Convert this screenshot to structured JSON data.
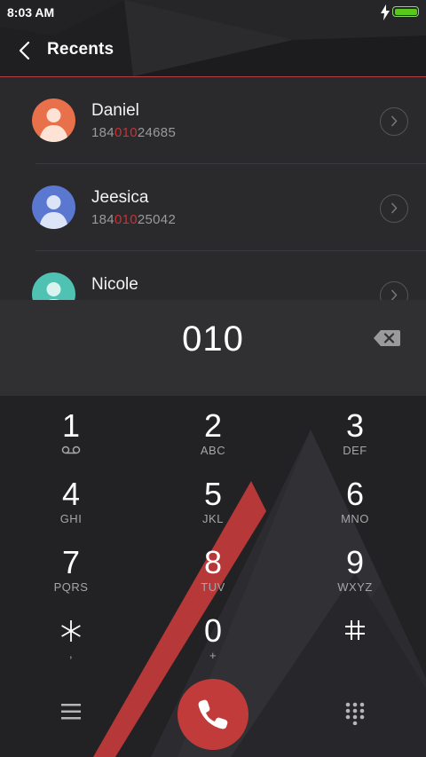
{
  "status_bar": {
    "time": "8:03 AM"
  },
  "header": {
    "title": "Recents"
  },
  "contacts": [
    {
      "name": "Daniel",
      "number_prefix": "184",
      "number_match": "010",
      "number_suffix": "24685",
      "avatar_color": "#e8704a"
    },
    {
      "name": "Jeesica",
      "number_prefix": "184",
      "number_match": "010",
      "number_suffix": "25042",
      "avatar_color": "#5b78d1"
    },
    {
      "name": "Nicole",
      "number_prefix": "",
      "number_match": "",
      "number_suffix": "",
      "avatar_color": "#4fc2b3"
    }
  ],
  "dialer": {
    "input": "010"
  },
  "keys": [
    {
      "digit": "1",
      "letters": "voicemail-icon"
    },
    {
      "digit": "2",
      "letters": "ABC"
    },
    {
      "digit": "3",
      "letters": "DEF"
    },
    {
      "digit": "4",
      "letters": "GHI"
    },
    {
      "digit": "5",
      "letters": "JKL"
    },
    {
      "digit": "6",
      "letters": "MNO"
    },
    {
      "digit": "7",
      "letters": "PQRS"
    },
    {
      "digit": "8",
      "letters": "TUV"
    },
    {
      "digit": "9",
      "letters": "WXYZ"
    },
    {
      "digit": "*",
      "letters": ","
    },
    {
      "digit": "0",
      "letters": "+"
    },
    {
      "digit": "#",
      "letters": ""
    }
  ],
  "colors": {
    "accent": "#c13b3b",
    "highlight": "#c93333",
    "header_line": "#b24040"
  }
}
